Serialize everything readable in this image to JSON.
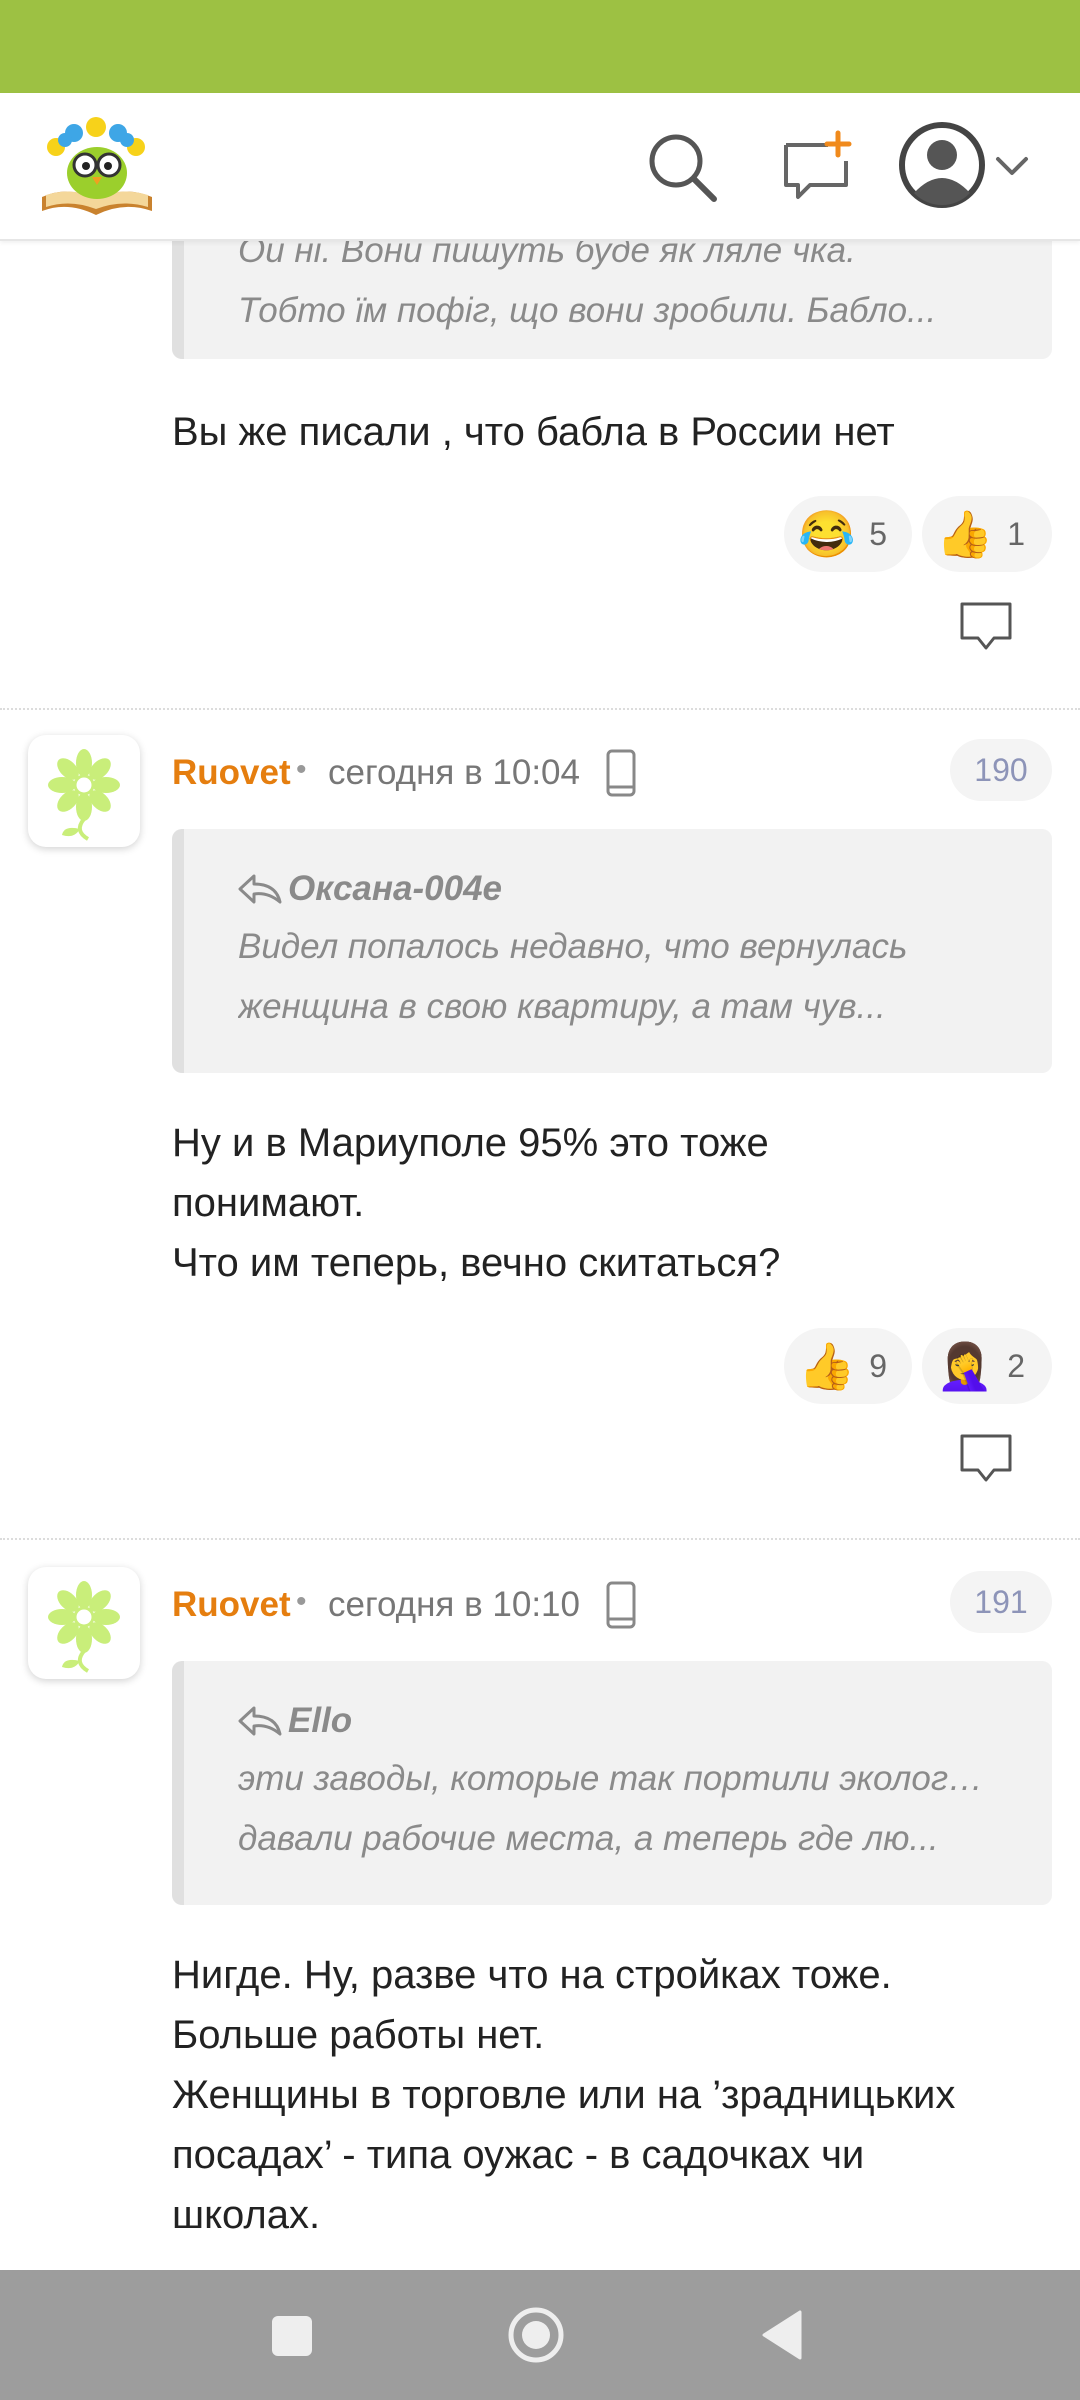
{
  "header": {
    "logo_icon": "owl-on-book-logo",
    "search_icon": "search-icon",
    "new_message_icon": "new-message-icon",
    "avatar_icon": "user-avatar-icon",
    "menu_chevron": "chevron-down-icon"
  },
  "colors": {
    "status_bar": "#9dc143",
    "author_name": "#e57e0f",
    "badge_text": "#8d94b8",
    "nav_bar": "#9d9d9d"
  },
  "comment_top": {
    "quote_line_1": "Ой ні. Вони пишуть буде як ляле чка.",
    "quote_line_2": "Тобто їм пофіг, що вони зробили. Бабло...",
    "text": "Вы же писали , что бабла в России нет",
    "reactions": [
      {
        "emoji": "😂",
        "count": "5"
      },
      {
        "emoji": "👍",
        "count": "1"
      }
    ]
  },
  "comment_190": {
    "author": "Ruovet",
    "separator": "•",
    "time": "сегодня в 10:04",
    "number": "190",
    "quote_author": "Оксана-004е",
    "quote_line_1": "Видел попалось недавно, что вернулась",
    "quote_line_2": "женщина в свою квартиру, а там чув...",
    "text_lines": [
      "Ну и в Мариуполе 95% это тоже",
      "понимают.",
      "Что им теперь, вечно скитаться?"
    ],
    "reactions": [
      {
        "emoji": "👍",
        "count": "9"
      },
      {
        "emoji": "🤦‍♀️",
        "count": "2"
      }
    ]
  },
  "comment_191": {
    "author": "Ruovet",
    "separator": "•",
    "time": "сегодня в 10:10",
    "number": "191",
    "quote_author": "Ello",
    "quote_line_1": "эти заводы, которые так портили экологию,",
    "quote_line_2": "давали рабочие места, а теперь где лю...",
    "text_lines": [
      "Нигде. Ну, разве что на стройках тоже.",
      "Больше работы нет.",
      "Женщины в торговле или на ’зрадницьких",
      "посадах’ - типа оужас - в садочках чи",
      "школах."
    ]
  },
  "navbar": {
    "recents_icon": "square-recents-icon",
    "home_icon": "circle-home-icon",
    "back_icon": "triangle-back-icon"
  }
}
